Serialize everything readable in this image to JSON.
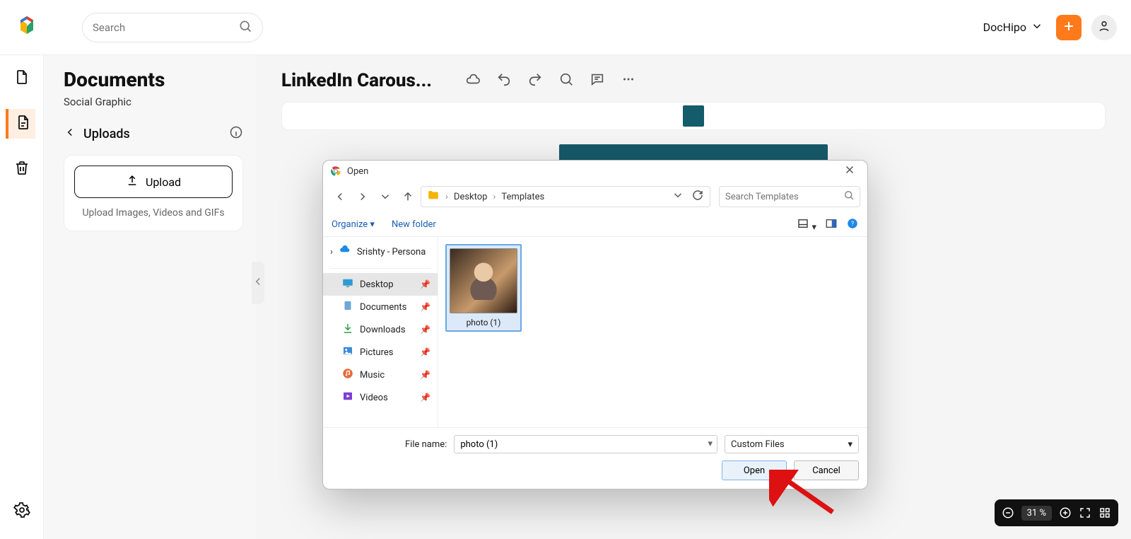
{
  "header": {
    "search_placeholder": "Search",
    "workspace_label": "DocHipo"
  },
  "panel": {
    "title": "Documents",
    "subtitle": "Social Graphic",
    "uploads_label": "Uploads",
    "upload_button": "Upload",
    "upload_hint": "Upload Images, Videos and GIFs"
  },
  "canvas": {
    "title": "LinkedIn Carous..."
  },
  "zoom": {
    "value": "31 %"
  },
  "dialog": {
    "title": "Open",
    "breadcrumb": [
      "Desktop",
      "Templates"
    ],
    "search_placeholder": "Search Templates",
    "toolbar": {
      "organize": "Organize",
      "new_folder": "New folder"
    },
    "sidebar": {
      "account": "Srishty - Persona",
      "items": [
        "Desktop",
        "Documents",
        "Downloads",
        "Pictures",
        "Music",
        "Videos"
      ]
    },
    "files": [
      {
        "name": "photo (1)"
      }
    ],
    "filename_label": "File name:",
    "filename_value": "photo (1)",
    "filetype": "Custom Files",
    "open_label": "Open",
    "cancel_label": "Cancel"
  },
  "colors": {
    "brand": "#ff7a1a",
    "teal": "#165a6a"
  }
}
